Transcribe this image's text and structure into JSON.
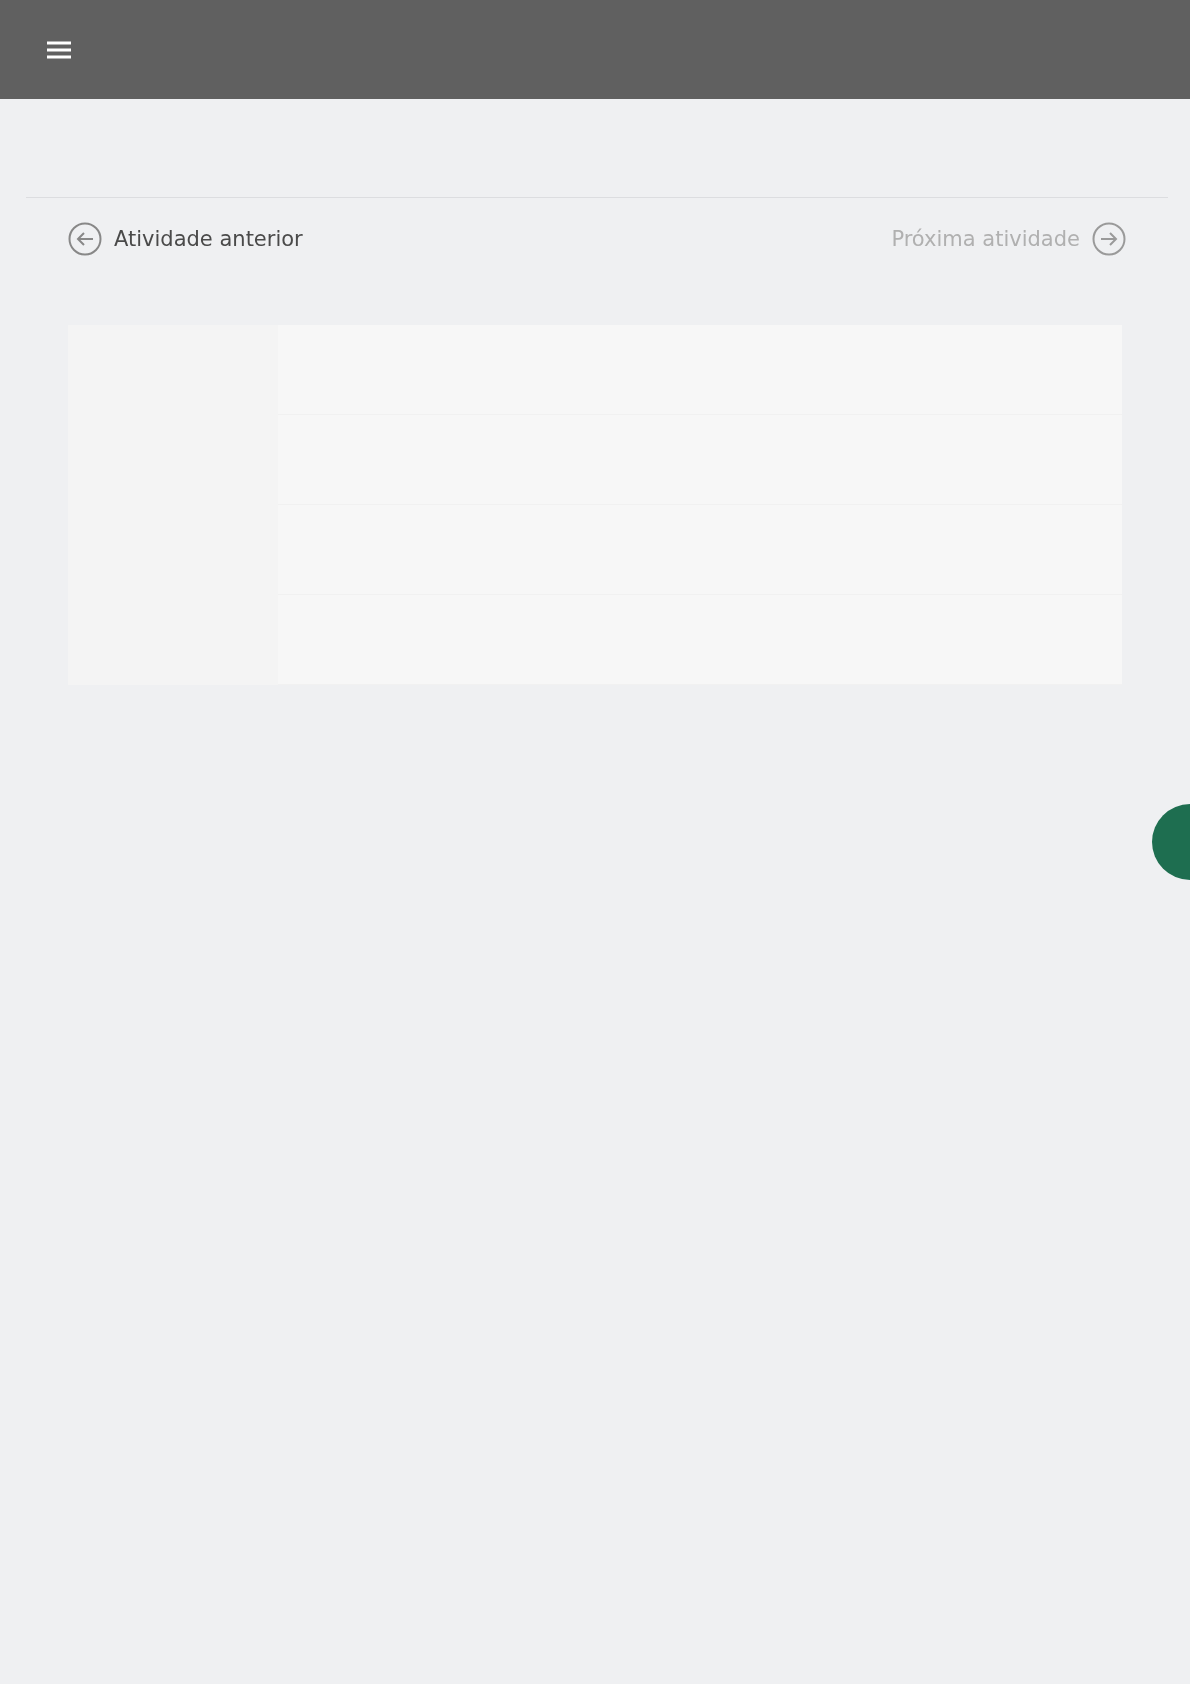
{
  "navigation": {
    "previous": {
      "label": "Atividade anterior",
      "disabled": false
    },
    "next": {
      "label": "Próxima atividade",
      "disabled": true
    }
  }
}
